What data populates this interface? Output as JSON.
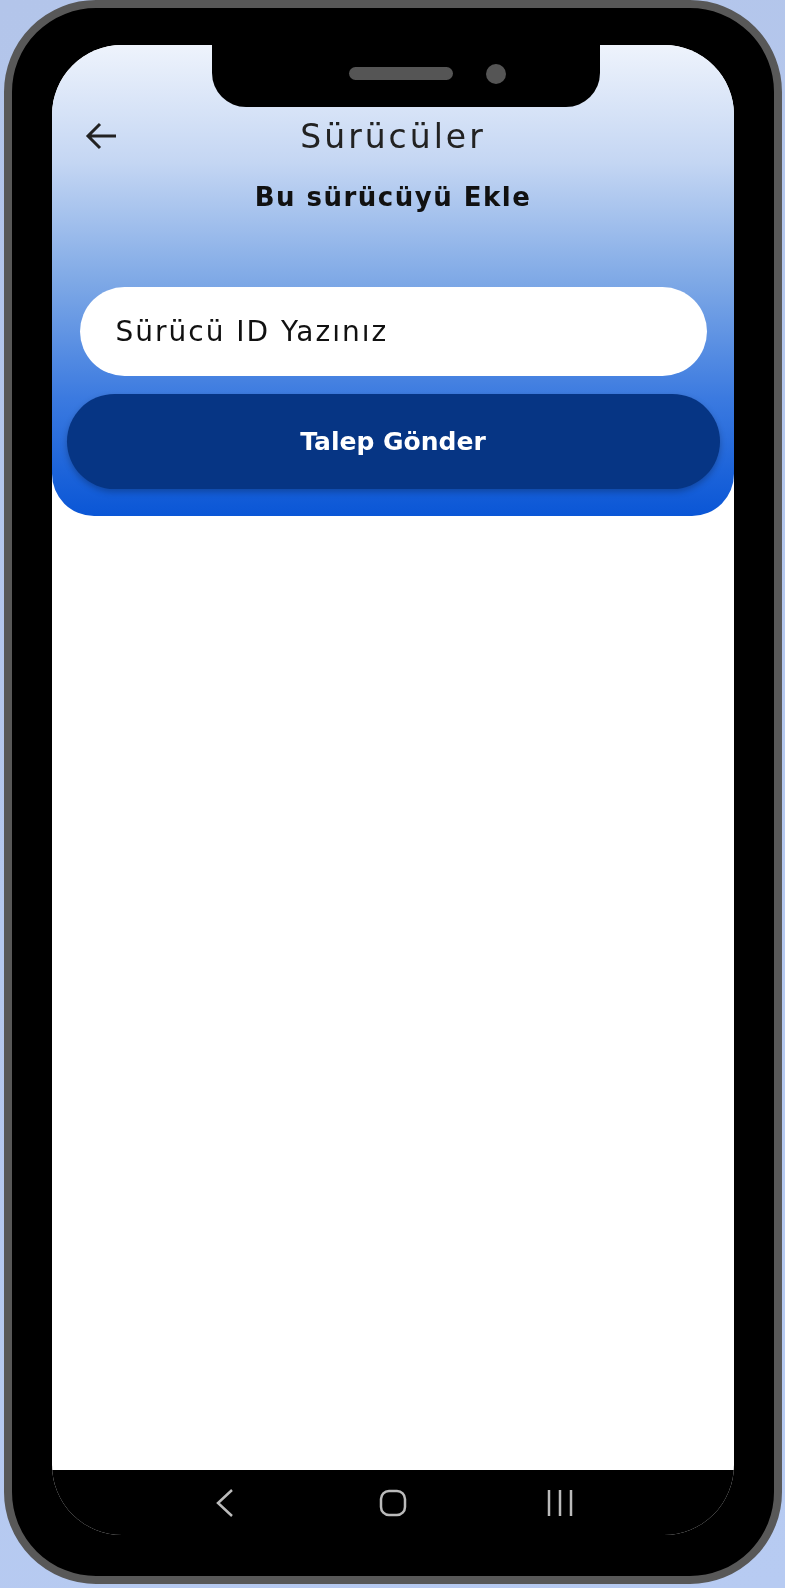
{
  "header": {
    "title": "Sürücüler",
    "subtitle": "Bu sürücüyü Ekle"
  },
  "field": {
    "placeholder": "Sürücü ID Yazınız"
  },
  "button": {
    "label": "Talep Gönder"
  }
}
